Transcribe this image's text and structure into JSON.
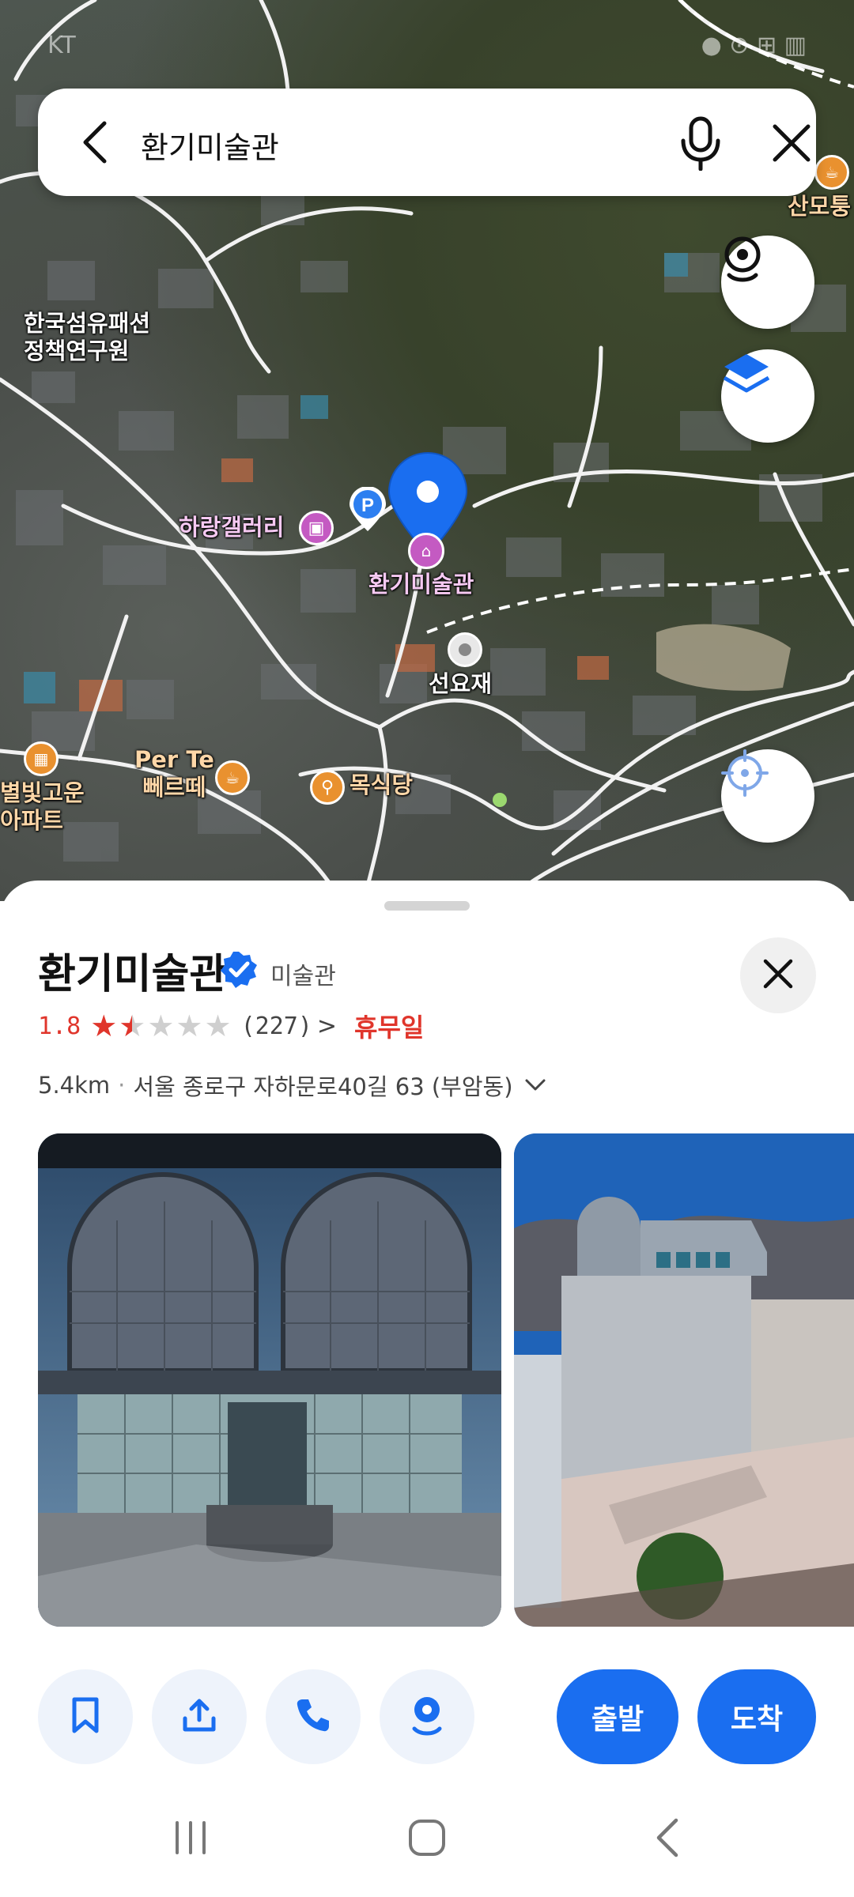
{
  "status_bar": {
    "left_text": "KT",
    "right_text": "●  ⊙  ⊞  ▥"
  },
  "search": {
    "query": "환기미술관",
    "back_icon": "back-arrow-icon",
    "mic_icon": "microphone-icon",
    "clear_icon": "close-icon"
  },
  "map": {
    "labels": {
      "textile": "한국섬유패션\n정책연구원",
      "harang": "하랑갤러리",
      "selected": "환기미술관",
      "seonyo": "선요재",
      "perte": "Per Te\n뻬르떼",
      "moksik": "목식당",
      "byeolbit": "별빛고운\n아파트",
      "sanmo": "산모퉁"
    },
    "parking_badge": "P",
    "fabs": [
      "street-view-icon",
      "layers-icon",
      "my-location-icon"
    ]
  },
  "place": {
    "title": "환기미술관",
    "category": "미술관",
    "rating": "1.8",
    "stars_filled": 1.5,
    "stars_total": 5,
    "review_count": "(227)",
    "review_chevron": ">",
    "status": "휴무일",
    "distance": "5.4km",
    "address": "서울 종로구 자하문로40길 63 (부암동)"
  },
  "actions": {
    "save_icon": "bookmark-icon",
    "share_icon": "share-icon",
    "call_icon": "phone-icon",
    "streetview_icon": "street-view-icon",
    "depart_label": "출발",
    "arrive_label": "도착"
  },
  "colors": {
    "accent": "#1a6ef0",
    "rating_red": "#e0352b",
    "marker_blue": "#1a6ef0"
  }
}
